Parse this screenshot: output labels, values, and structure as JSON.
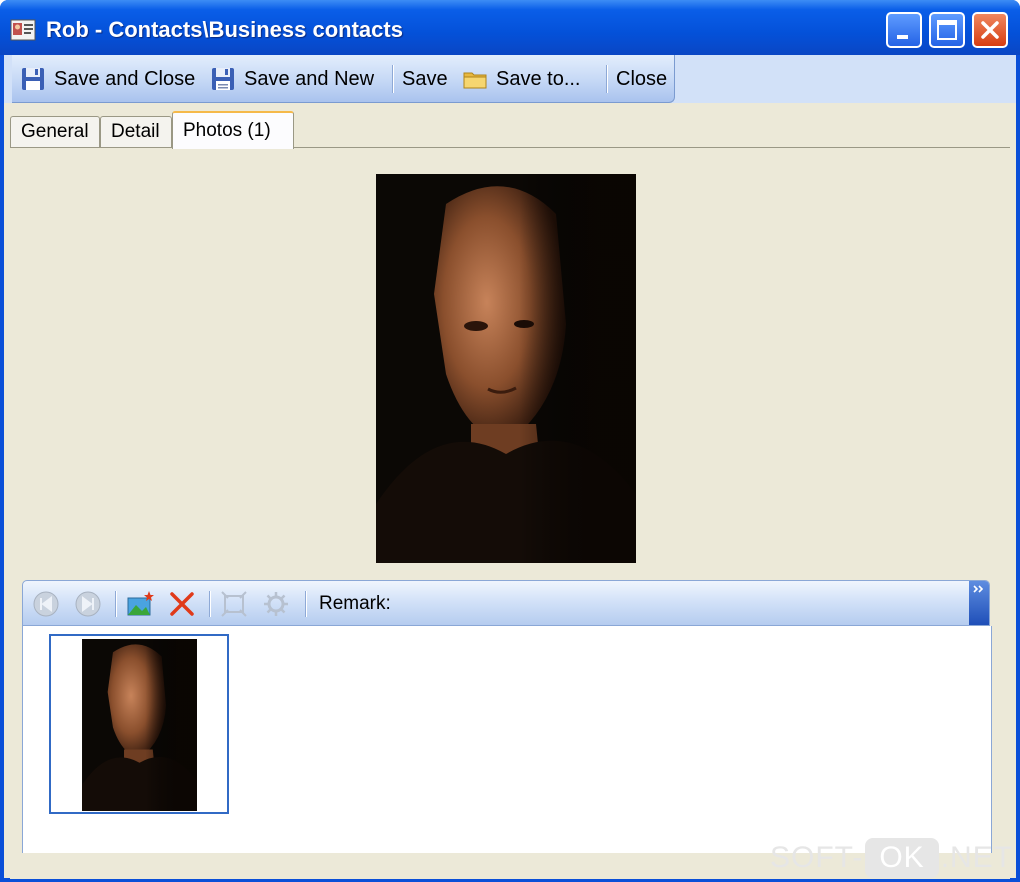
{
  "window": {
    "title": "Rob - Contacts\\Business contacts",
    "controls": [
      "minimize",
      "maximize",
      "close"
    ]
  },
  "toolbar": {
    "items": [
      {
        "label": "Save and Close",
        "icon": "floppy-disk-icon"
      },
      {
        "label": "Save and New",
        "icon": "floppy-disk-new-icon"
      },
      {
        "label": "Save"
      },
      {
        "label": "Save to...",
        "icon": "folder-icon"
      },
      {
        "label": "Close"
      }
    ]
  },
  "tabs": [
    {
      "label": "General",
      "active": false
    },
    {
      "label": "Detail",
      "active": false
    },
    {
      "label": "Photos (1)",
      "active": true
    }
  ],
  "photos": {
    "remark_label": "Remark:",
    "buttons": [
      "previous-icon",
      "next-icon",
      "add-photo-icon",
      "delete-icon",
      "fit-icon",
      "settings-icon"
    ],
    "thumbnail_count": 1
  },
  "watermark": {
    "left": "SOFT-",
    "box": "OK",
    "right": ".NET"
  },
  "colors": {
    "titlebar": "#0451d9",
    "client": "#ece9d8",
    "toolbar": "#c8daf6",
    "selection": "#316ac5",
    "delete_red": "#e03a1a"
  }
}
